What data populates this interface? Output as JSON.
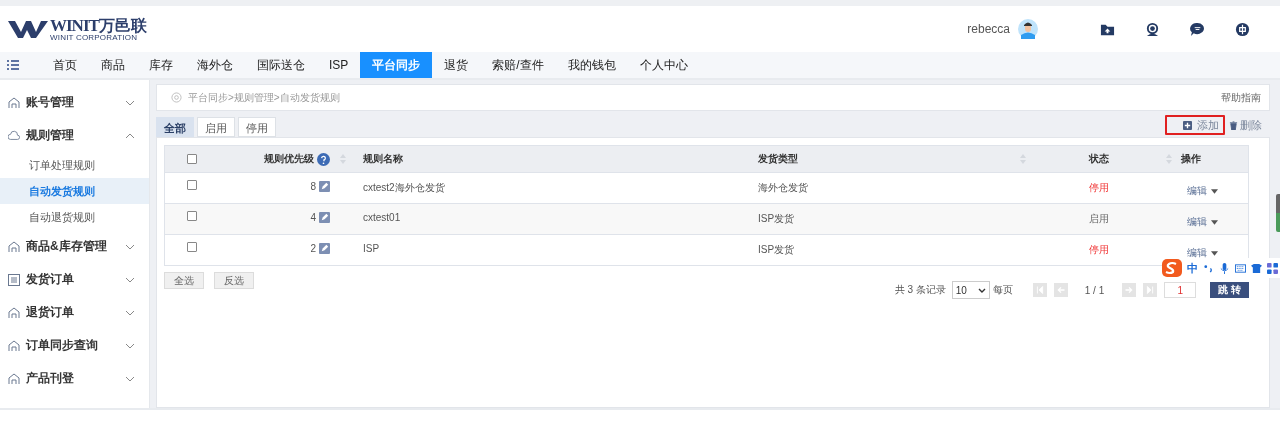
{
  "header": {
    "logo_mark": "WINIT",
    "logo_cn": "万邑联",
    "logo_sub": "WINIT CORPORATION",
    "user": "rebecca"
  },
  "nav": [
    {
      "label": "首页",
      "selected": false
    },
    {
      "label": "商品",
      "selected": false
    },
    {
      "label": "库存",
      "selected": false
    },
    {
      "label": "海外仓",
      "selected": false
    },
    {
      "label": "国际送仓",
      "selected": false
    },
    {
      "label": "ISP",
      "selected": false
    },
    {
      "label": "平台同步",
      "selected": true
    },
    {
      "label": "退货",
      "selected": false
    },
    {
      "label": "索赔/查件",
      "selected": false
    },
    {
      "label": "我的钱包",
      "selected": false
    },
    {
      "label": "个人中心",
      "selected": false
    }
  ],
  "sidebar": [
    {
      "label": "账号管理",
      "expanded": false,
      "kind": "house"
    },
    {
      "label": "规则管理",
      "expanded": true,
      "kind": "cloud",
      "children": [
        {
          "label": "订单处理规则",
          "selected": false
        },
        {
          "label": "自动发货规则",
          "selected": true
        },
        {
          "label": "自动退货规则",
          "selected": false
        }
      ]
    },
    {
      "label": "商品&库存管理",
      "expanded": false,
      "kind": "house"
    },
    {
      "label": "发货订单",
      "expanded": false,
      "kind": "list"
    },
    {
      "label": "退货订单",
      "expanded": false,
      "kind": "house"
    },
    {
      "label": "订单同步查询",
      "expanded": false,
      "kind": "house"
    },
    {
      "label": "产品刊登",
      "expanded": false,
      "kind": "house"
    }
  ],
  "breadcrumb": [
    {
      "label": "平台同步",
      "sep": ">"
    },
    {
      "label": "规则管理",
      "sep": ">"
    },
    {
      "label": "自动发货规则"
    }
  ],
  "help_link": "帮助指南",
  "tabs": [
    {
      "label": "全部",
      "selected": true
    },
    {
      "label": "启用",
      "selected": false
    },
    {
      "label": "停用",
      "selected": false
    }
  ],
  "actions": {
    "add": "添加",
    "delete": "删除"
  },
  "table": {
    "all_checked": false,
    "columns": [
      "规则优先级",
      "规则名称",
      "发货类型",
      "状态",
      "操作"
    ],
    "rows": [
      {
        "checked": false,
        "priority": "8",
        "name": "cxtest2海外仓发货",
        "type": "海外仓发货",
        "status": "停用",
        "enabled": false,
        "action": "编辑"
      },
      {
        "checked": false,
        "priority": "4",
        "name": "cxtest01",
        "type": "ISP发货",
        "status": "启用",
        "enabled": true,
        "action": "编辑"
      },
      {
        "checked": false,
        "priority": "2",
        "name": "ISP",
        "type": "ISP发货",
        "status": "停用",
        "enabled": false,
        "action": "编辑"
      }
    ]
  },
  "select_all": "全选",
  "invert": "反选",
  "pagination": {
    "total": "共 3 条记录",
    "page_size": "10",
    "per_page": "每页",
    "page": "1 / 1",
    "jump_value": "1",
    "jump": "跳 转"
  },
  "ime": {
    "label": "中"
  }
}
